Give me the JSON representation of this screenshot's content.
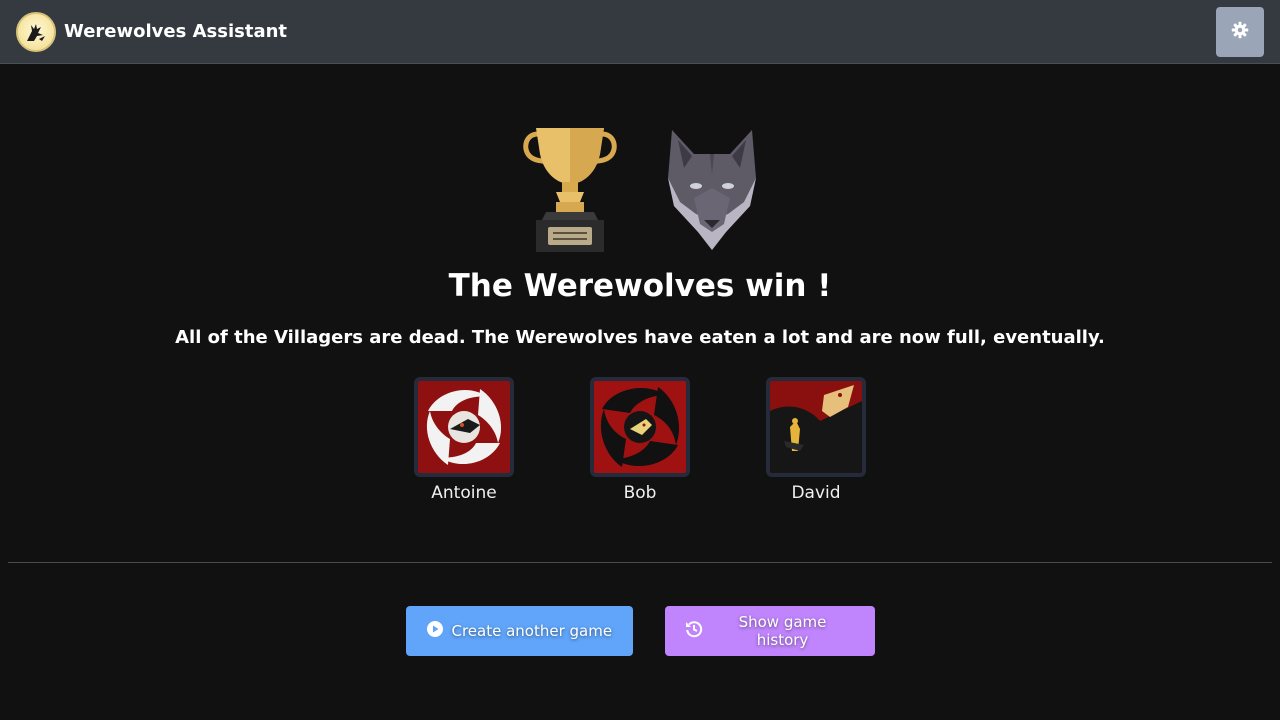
{
  "app": {
    "title": "Werewolves Assistant",
    "logo_icon": "werewolf-moon-logo-icon",
    "settings_icon": "gear-icon"
  },
  "result": {
    "title": "The Werewolves win !",
    "description": "All of the Villagers are dead. The Werewolves have eaten a lot and are now full, eventually.",
    "icons": [
      "trophy-icon",
      "wolf-head-icon"
    ]
  },
  "players": [
    {
      "name": "Antoine",
      "role_icon": "white-werewolf-card-icon"
    },
    {
      "name": "Bob",
      "role_icon": "werewolf-card-icon"
    },
    {
      "name": "David",
      "role_icon": "big-bad-wolf-card-icon"
    }
  ],
  "actions": {
    "create_label": "Create another game",
    "history_label": "Show game history"
  },
  "colors": {
    "background": "#111111",
    "topbar": "#343a40",
    "settings_button": "#9aa5b8",
    "create_button": "#60a5fa",
    "history_button": "#c084fc"
  }
}
